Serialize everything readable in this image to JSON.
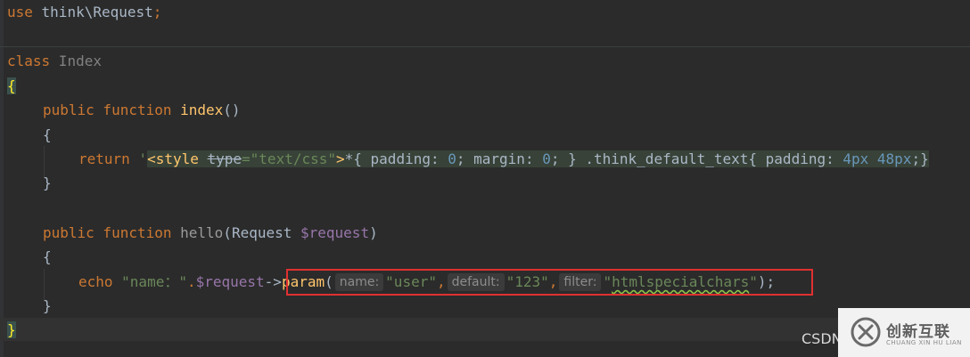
{
  "code": {
    "l1": {
      "kw_use": "use",
      "ns": " think\\Request",
      "semi": ";"
    },
    "l2": {
      "kw_class": "class",
      "name": " Index"
    },
    "l3": {
      "brace": "{"
    },
    "l4": {
      "kw_public": "public",
      "kw_function": " function",
      "fname": " index",
      "parens": "()"
    },
    "l5": {
      "brace": "{"
    },
    "l6": {
      "kw_return": "return",
      "quote": " '",
      "tag_open": "<style ",
      "attr": "type",
      "eq_val": "=\"text/css\"",
      "gt": ">",
      "css1": "*{ padding: ",
      "n0a": "0",
      "css2": "; margin: ",
      "n0b": "0",
      "css3": "; } .think_default_text{ padding: ",
      "n4": "4px",
      "sp": " ",
      "n48": "48px",
      "css4": ";}"
    },
    "l7": {
      "brace": "}"
    },
    "l8": {
      "kw_public": "public",
      "kw_function": " function",
      "fname": " hello",
      "paren_open": "(",
      "ptype": "Request",
      "pvar": " $request",
      "paren_close": ")"
    },
    "l9": {
      "brace": "{"
    },
    "l10": {
      "kw_echo": "echo",
      "str1": " \"name：\"",
      "dot": ".",
      "var": "$request",
      "arrow": "->",
      "method": "param",
      "paren_open": "(",
      "hint_name": "name:",
      "arg1": "\"user\"",
      "comma1": ",",
      "hint_default": "default:",
      "arg2": "\"123\"",
      "comma2": ",",
      "hint_filter": "filter:",
      "arg3_q1": "\"",
      "arg3_body": "htmlspecialchars",
      "arg3_q2": "\"",
      "close": ");"
    },
    "l11": {
      "brace": "}"
    },
    "l12": {
      "brace": "}"
    }
  },
  "watermark": {
    "csdn": "CSDN",
    "brand": "创新互联",
    "brand_sub": "CHUANG XIN HU LIAN"
  },
  "colors": {
    "background": "#2b2b2b",
    "keyword": "#cc7832",
    "function": "#ffc66d",
    "string": "#6a8759",
    "number": "#6897bb",
    "variable": "#9876aa",
    "highlight_border": "#e03030"
  }
}
